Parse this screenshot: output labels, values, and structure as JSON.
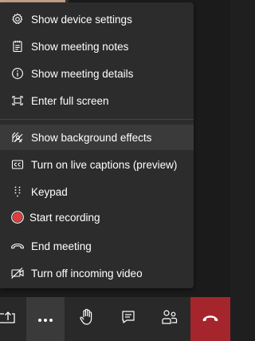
{
  "menu": {
    "items": [
      {
        "label": "Show device settings",
        "icon": "gear-icon"
      },
      {
        "label": "Show meeting notes",
        "icon": "notes-icon"
      },
      {
        "label": "Show meeting details",
        "icon": "info-icon"
      },
      {
        "label": "Enter full screen",
        "icon": "fullscreen-icon"
      },
      {
        "label": "Show background effects",
        "icon": "background-effects-icon"
      },
      {
        "label": "Turn on live captions (preview)",
        "icon": "captions-icon"
      },
      {
        "label": "Keypad",
        "icon": "keypad-icon"
      },
      {
        "label": "Start recording",
        "icon": "record-icon"
      },
      {
        "label": "End meeting",
        "icon": "end-meeting-icon"
      },
      {
        "label": "Turn off incoming video",
        "icon": "video-off-icon"
      }
    ]
  },
  "toolbar": {
    "buttons": [
      {
        "icon": "share-icon"
      },
      {
        "icon": "more-options-icon"
      },
      {
        "icon": "raise-hand-icon"
      },
      {
        "icon": "chat-icon"
      },
      {
        "icon": "participants-icon"
      },
      {
        "icon": "hang-up-icon"
      }
    ]
  },
  "colors": {
    "menu_bg": "#2d2c2c",
    "highlight_bg": "#3b3a3a",
    "record_red": "#e03c3c",
    "hangup_bg": "#a4262c",
    "text": "#ffffff"
  }
}
